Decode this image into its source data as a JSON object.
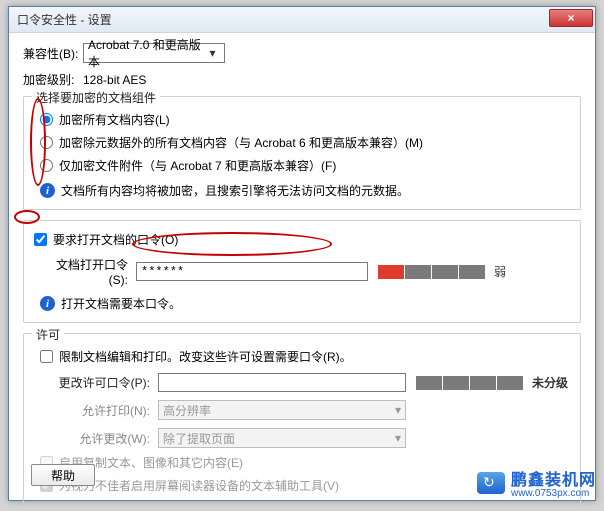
{
  "window": {
    "title": "口令安全性 - 设置",
    "close": "×"
  },
  "compat": {
    "label": "兼容性(B):",
    "value": "Acrobat 7.0 和更高版本"
  },
  "enclevel": {
    "label": "加密级别:",
    "value": "128-bit AES"
  },
  "group1": {
    "legend": "选择要加密的文档组件",
    "r1": "加密所有文档内容(L)",
    "r2": "加密除元数据外的所有文档内容（与 Acrobat 6 和更高版本兼容）(M)",
    "r3": "仅加密文件附件（与 Acrobat 7 和更高版本兼容）(F)",
    "info": "文档所有内容均将被加密，且搜索引擎将无法访问文档的元数据。"
  },
  "openpw": {
    "chk": "要求打开文档的口令(O)",
    "label": "文档打开口令(S):",
    "value": "******",
    "strength": "弱",
    "info": "打开文档需要本口令。"
  },
  "perm": {
    "legend": "许可",
    "chk1": "限制文档编辑和打印。改变这些许可设置需要口令(R)。",
    "pwlabel": "更改许可口令(P):",
    "rating": "未分级",
    "printlabel": "允许打印(N):",
    "printval": "高分辨率",
    "changelabel": "允许更改(W):",
    "changeval": "除了提取页面",
    "chk2": "启用复制文本、图像和其它内容(E)",
    "chk3": "为视力不佳者启用屏幕阅读器设备的文本辅助工具(V)"
  },
  "help": "帮助",
  "watermark": {
    "name": "鹏鑫装机网",
    "url": "www.0753px.com"
  },
  "info_glyph": "i",
  "dropdown_arrow": "▾"
}
